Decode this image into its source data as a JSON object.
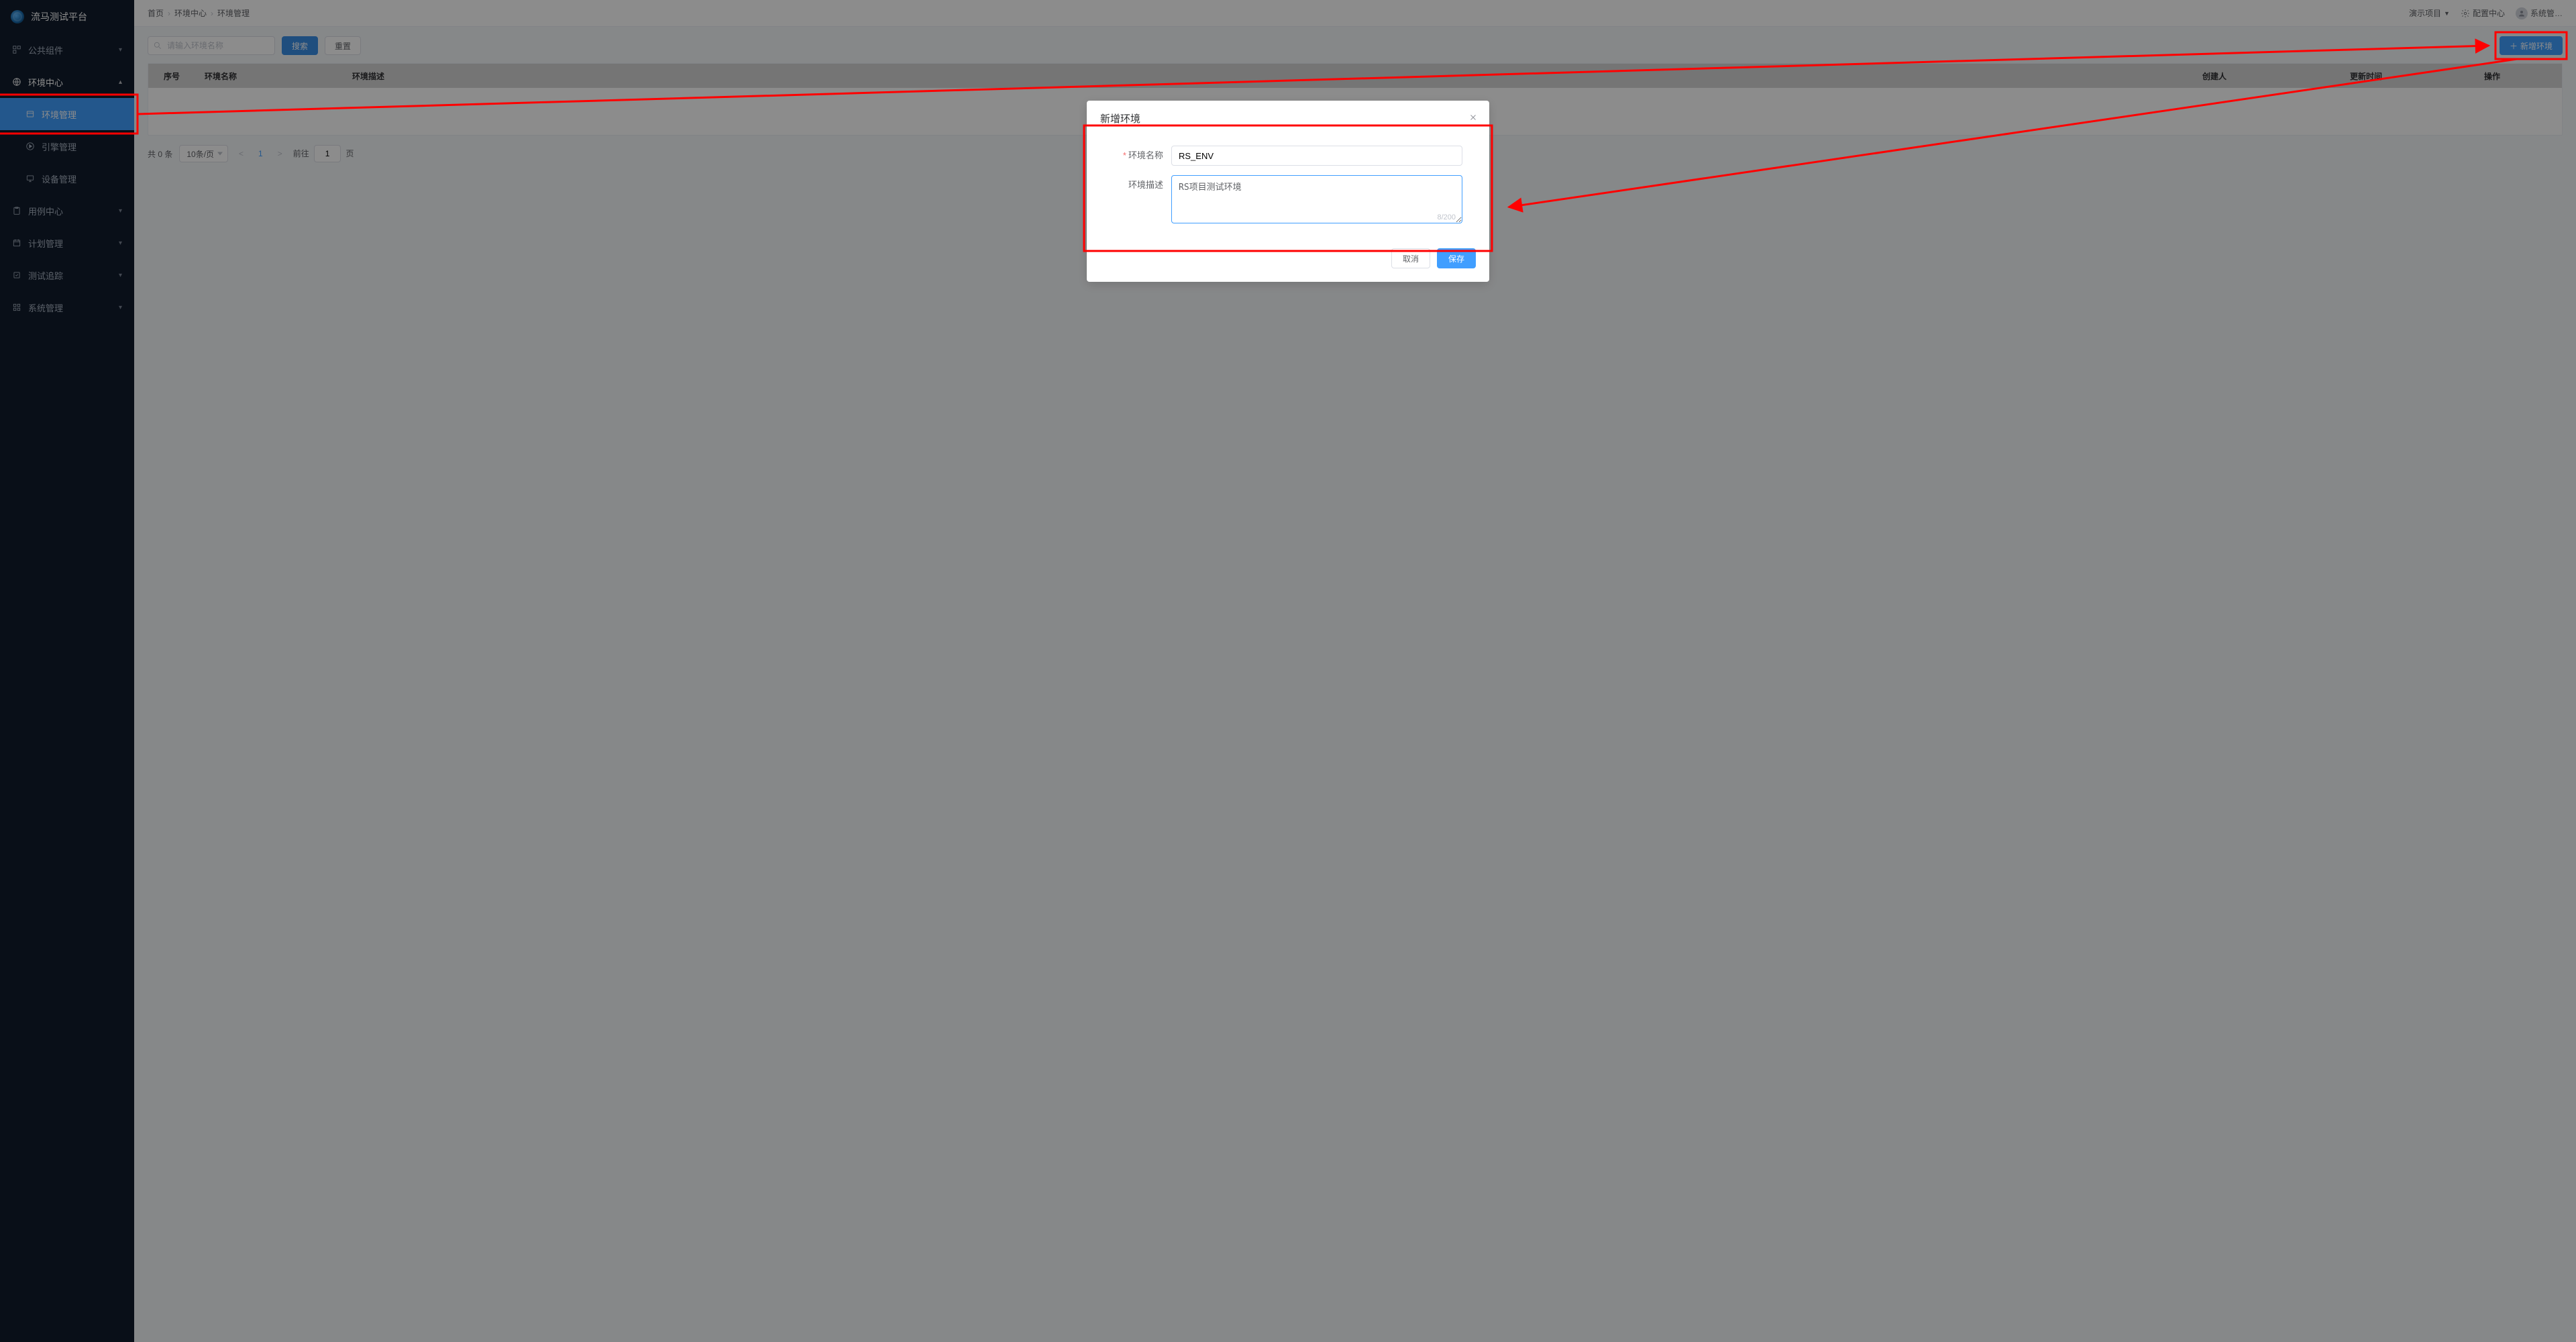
{
  "app": {
    "title": "流马测试平台"
  },
  "sidebar": {
    "items": [
      {
        "label": "公共组件",
        "icon": "component"
      },
      {
        "label": "环境中心",
        "icon": "globe",
        "open": true,
        "children": [
          {
            "label": "环境管理",
            "icon": "layers",
            "active": true
          },
          {
            "label": "引擎管理",
            "icon": "play"
          },
          {
            "label": "设备管理",
            "icon": "monitor"
          }
        ]
      },
      {
        "label": "用例中心",
        "icon": "clipboard"
      },
      {
        "label": "计划管理",
        "icon": "calendar"
      },
      {
        "label": "测试追踪",
        "icon": "target"
      },
      {
        "label": "系统管理",
        "icon": "grid"
      }
    ]
  },
  "breadcrumb": {
    "a": "首页",
    "b": "环境中心",
    "c": "环境管理"
  },
  "topbar": {
    "project": "演示项目",
    "config": "配置中心",
    "user": "系统管…"
  },
  "toolbar": {
    "search_placeholder": "请输入环境名称",
    "search_btn": "搜索",
    "reset_btn": "重置",
    "add_btn": "新增环境"
  },
  "table": {
    "columns": {
      "idx": "序号",
      "name": "环境名称",
      "desc": "环境描述",
      "creator": "创建人",
      "time": "更新时间",
      "op": "操作"
    }
  },
  "pager": {
    "total": "共 0 条",
    "page_size": "10条/页",
    "current": "1",
    "goto_prefix": "前往",
    "goto_value": "1",
    "goto_suffix": "页"
  },
  "dialog": {
    "title": "新增环境",
    "name_label": "环境名称",
    "name_value": "RS_ENV",
    "desc_label": "环境描述",
    "desc_value": "RS项目测试环境",
    "counter": "8/200",
    "cancel": "取消",
    "save": "保存"
  }
}
